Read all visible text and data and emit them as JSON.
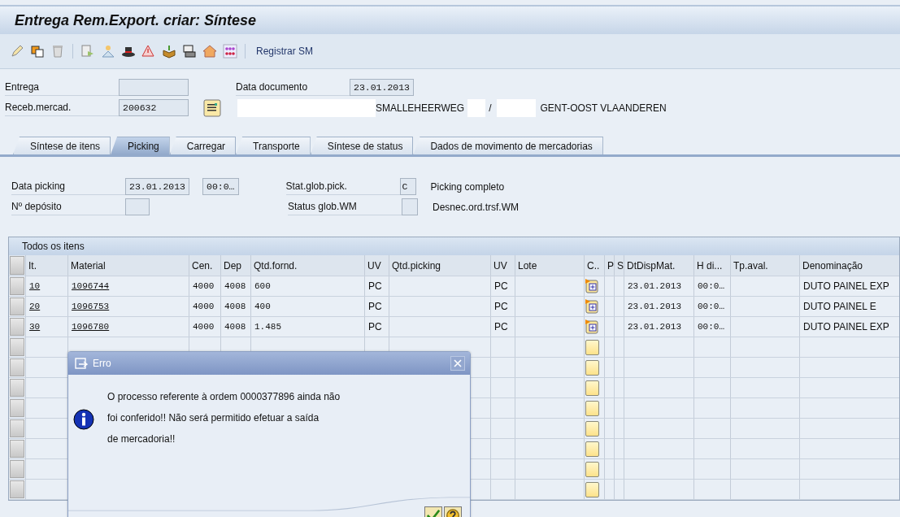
{
  "window": {
    "title": "Entrega Rem.Export.  criar: Síntese"
  },
  "toolbar": {
    "icons": [
      {
        "kind": "pencil"
      },
      {
        "kind": "copy"
      },
      {
        "kind": "trash"
      },
      {
        "kind": "separator"
      },
      {
        "kind": "doc"
      },
      {
        "kind": "person"
      },
      {
        "kind": "hat"
      },
      {
        "kind": "warning"
      },
      {
        "kind": "box"
      },
      {
        "kind": "machine"
      },
      {
        "kind": "house"
      },
      {
        "kind": "grid"
      },
      {
        "kind": "separator"
      }
    ],
    "action": "Registrar SM"
  },
  "header": {
    "delivery_label": "Entrega",
    "recipient_label": "Receb.mercad.",
    "recipient_value": "200632",
    "doc_date_label": "Data documento",
    "doc_date_value": "23.01.2013",
    "address": [
      {
        "kind": "redacted"
      },
      {
        "kind": "text",
        "text": "SMALLEHEERWEG"
      },
      {
        "kind": "redacted"
      },
      {
        "kind": "text",
        "text": "/"
      },
      {
        "kind": "redacted"
      },
      {
        "kind": "text",
        "text": "GENT-OOST VLAANDEREN"
      }
    ]
  },
  "tabs": [
    {
      "label": "Síntese de itens",
      "selected": false
    },
    {
      "label": "Picking",
      "selected": true
    },
    {
      "label": "Carregar",
      "selected": false
    },
    {
      "label": "Transporte",
      "selected": false
    },
    {
      "label": "Síntese de status",
      "selected": false
    },
    {
      "label": "Dados de movimento de mercadorias",
      "selected": false
    }
  ],
  "picking": {
    "date_label": "Data picking",
    "date_value": "23.01.2013",
    "time_value": "00:0…",
    "warehouse_label": "Nº depósito",
    "pick_status_label": "Stat.glob.pick.",
    "pick_status_value": "C",
    "pick_status_text": "Picking completo",
    "wm_status_label": "Status glob.WM",
    "wm_status_text": "Desnec.ord.trsf.WM"
  },
  "table": {
    "title": "Todos os itens",
    "columns": [
      "It.",
      "Material",
      "Cen.",
      "Dep",
      "Qtd.fornd.",
      "UV",
      "Qtd.picking",
      "UV",
      "Lote",
      "C..",
      "P",
      "S",
      "DtDispMat.",
      "H di...",
      "Tp.aval.",
      "Denominação"
    ],
    "rows": [
      {
        "kind": "item",
        "it": "10",
        "material": "1096744",
        "cen": "4000",
        "dep": "4008",
        "qtd": "600",
        "uv": "PC",
        "uv2": "PC",
        "date": "23.01.2013",
        "time": "00:0…",
        "name": "DUTO PAINEL EXP"
      },
      {
        "kind": "item",
        "it": "20",
        "material": "1096753",
        "cen": "4000",
        "dep": "4008",
        "qtd": "400",
        "uv": "PC",
        "uv2": "PC",
        "date": "23.01.2013",
        "time": "00:0…",
        "name": "DUTO PAINEL E"
      },
      {
        "kind": "item",
        "it": "30",
        "material": "1096780",
        "cen": "4000",
        "dep": "4008",
        "qtd": "1.485",
        "uv": "PC",
        "uv2": "PC",
        "date": "23.01.2013",
        "time": "00:0…",
        "name": "DUTO PAINEL EXP"
      },
      {
        "kind": "empty"
      },
      {
        "kind": "empty"
      },
      {
        "kind": "empty"
      },
      {
        "kind": "empty"
      },
      {
        "kind": "empty"
      },
      {
        "kind": "empty"
      },
      {
        "kind": "empty"
      },
      {
        "kind": "empty"
      }
    ]
  },
  "dialog": {
    "title": "Erro",
    "message_lines": [
      "O processo referente à ordem 0000377896 ainda não",
      "foi conferido!! Não será permitido efetuar a saída",
      "de mercadoria!!"
    ]
  }
}
